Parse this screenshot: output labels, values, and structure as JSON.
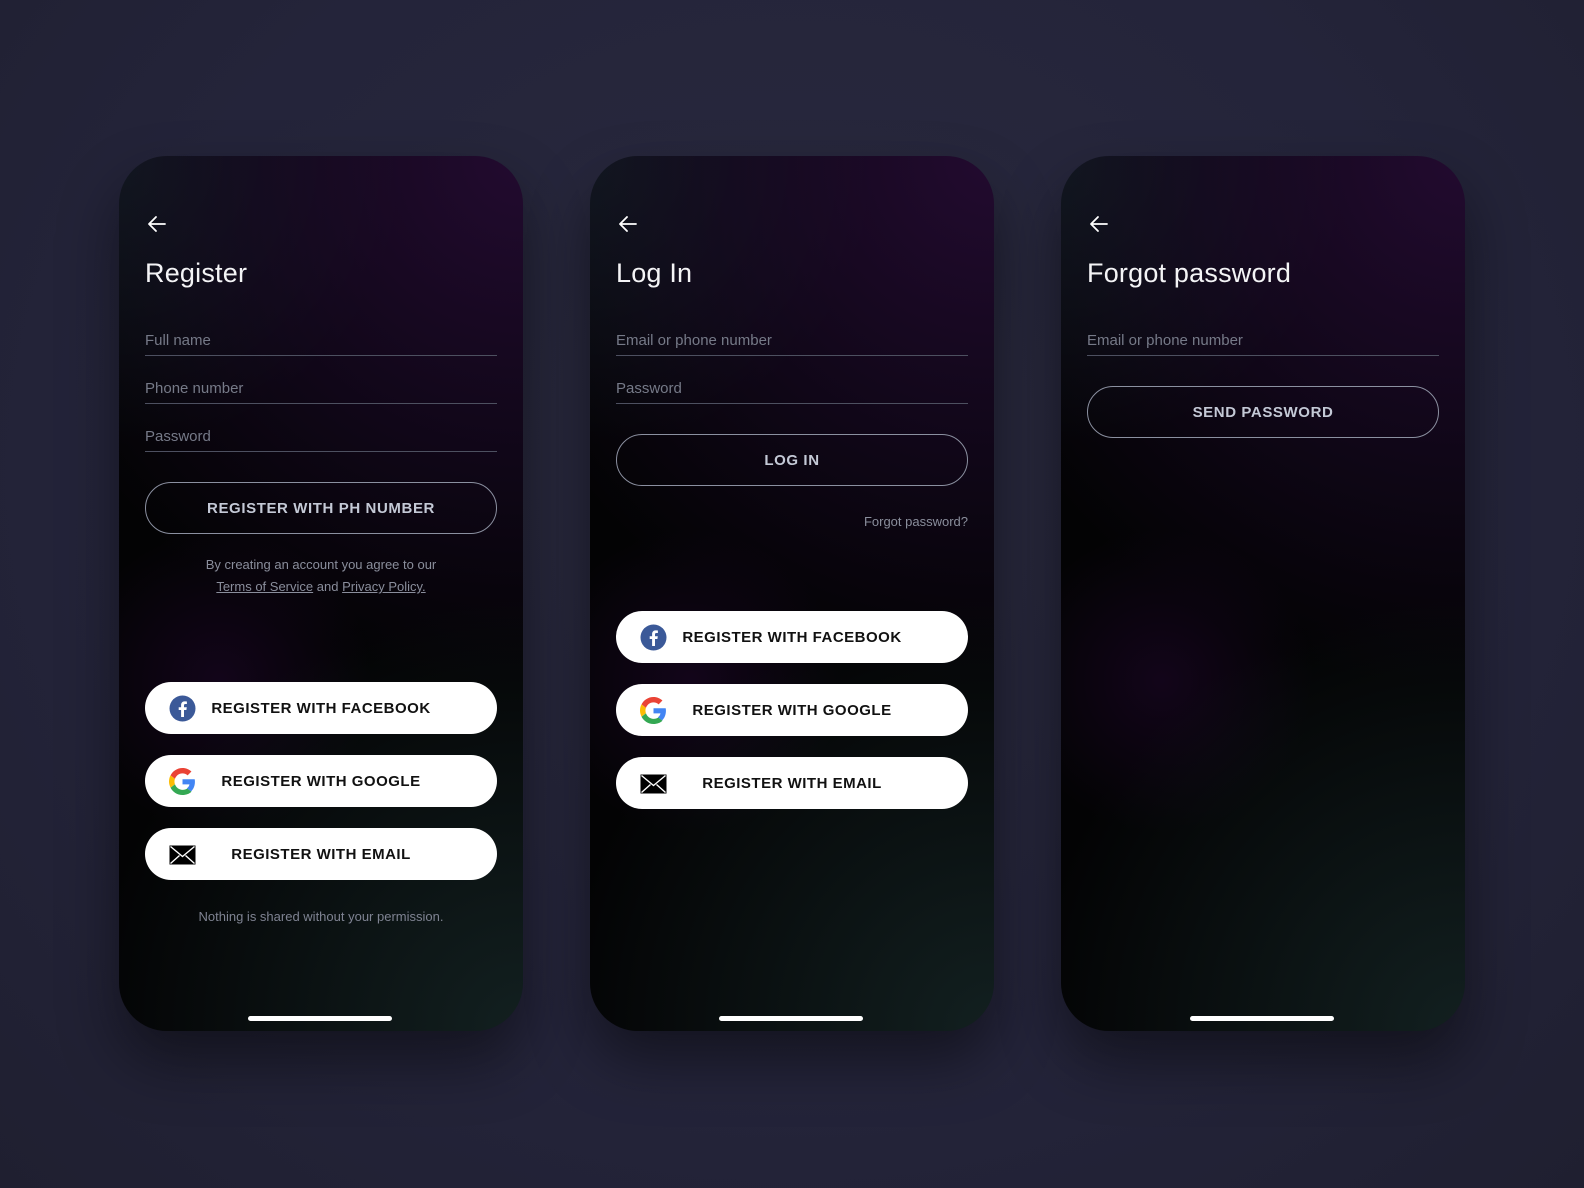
{
  "screens": {
    "register": {
      "title": "Register",
      "fields": [
        {
          "placeholder": "Full name",
          "value": ""
        },
        {
          "placeholder": "Phone number",
          "value": ""
        },
        {
          "placeholder": "Password",
          "value": ""
        }
      ],
      "primary_button": "REGISTER WITH  PH NUMBER",
      "terms": {
        "line1": "By creating an account you agree to our",
        "terms_link": "Terms of Service",
        "and": "and",
        "privacy_link": "Privacy Policy."
      },
      "social": [
        {
          "label": "REGISTER WITH FACEBOOK",
          "icon": "facebook-icon"
        },
        {
          "label": "REGISTER WITH GOOGLE",
          "icon": "google-icon"
        },
        {
          "label": "REGISTER WITH EMAIL",
          "icon": "mail-icon"
        }
      ],
      "note": "Nothing is shared without your permission."
    },
    "login": {
      "title": "Log In",
      "fields": [
        {
          "placeholder": "Email or phone number",
          "value": ""
        },
        {
          "placeholder": "Password",
          "value": ""
        }
      ],
      "primary_button": "LOG IN",
      "forgot_link": "Forgot password?",
      "social": [
        {
          "label": "REGISTER WITH FACEBOOK",
          "icon": "facebook-icon"
        },
        {
          "label": "REGISTER WITH GOOGLE",
          "icon": "google-icon"
        },
        {
          "label": "REGISTER WITH EMAIL",
          "icon": "mail-icon"
        }
      ]
    },
    "forgot": {
      "title": "Forgot password",
      "fields": [
        {
          "placeholder": "Email or phone number",
          "value": ""
        }
      ],
      "primary_button": "SEND PASSWORD"
    }
  },
  "icons": {
    "back": "arrow-left-icon"
  },
  "colors": {
    "background": "#262639",
    "facebook": "#3b5998",
    "google_blue": "#4285F4",
    "google_red": "#EA4335",
    "google_yellow": "#FBBC05",
    "google_green": "#34A853",
    "outline": "#8b90a0"
  }
}
